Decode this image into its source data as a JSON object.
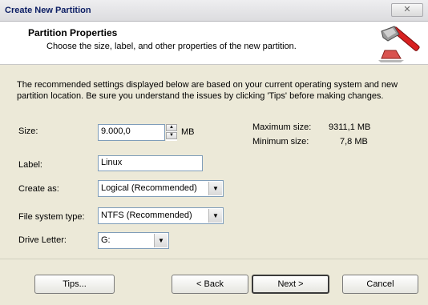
{
  "window": {
    "title": "Create New Partition",
    "close_glyph": "✕"
  },
  "header": {
    "title": "Partition Properties",
    "subtitle": "Choose the size, label, and other properties of the new partition.",
    "icon": "hammer-icon"
  },
  "intro_text": "The recommended settings displayed below are based on your current operating system and new partition location. Be sure you understand the issues by clicking 'Tips' before making changes.",
  "form": {
    "size": {
      "label": "Size:",
      "value": "9.000,0",
      "unit": "MB"
    },
    "label": {
      "label": "Label:",
      "value": "Linux"
    },
    "create_as": {
      "label": "Create as:",
      "value": "Logical (Recommended)"
    },
    "file_system": {
      "label": "File system type:",
      "value": "NTFS (Recommended)"
    },
    "drive_letter": {
      "label": "Drive Letter:",
      "value": "G:"
    }
  },
  "info": {
    "max_label": "Maximum size:",
    "max_value": "9311,1 MB",
    "min_label": "Minimum size:",
    "min_value": "7,8 MB"
  },
  "buttons": {
    "tips": "Tips...",
    "back": "< Back",
    "next": "Next >",
    "cancel": "Cancel"
  }
}
